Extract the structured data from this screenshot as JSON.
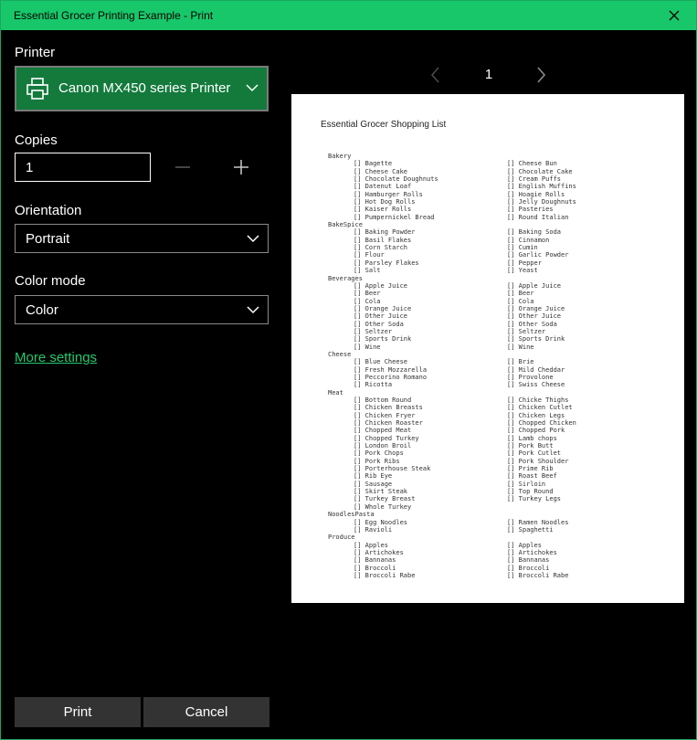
{
  "window": {
    "title": "Essential Grocer Printing Example - Print"
  },
  "printer": {
    "label": "Printer",
    "selected": "Canon MX450 series Printer"
  },
  "copies": {
    "label": "Copies",
    "value": "1"
  },
  "orientation": {
    "label": "Orientation",
    "selected": "Portrait"
  },
  "color_mode": {
    "label": "Color mode",
    "selected": "Color"
  },
  "more_settings": "More settings",
  "buttons": {
    "print": "Print",
    "cancel": "Cancel"
  },
  "pager": {
    "page": "1"
  },
  "preview": {
    "title": "Essential Grocer Shopping List",
    "categories": [
      {
        "name": "Bakery",
        "items": [
          [
            "[] Bagette",
            "[] Cheese Bun"
          ],
          [
            "[] Cheese Cake",
            "[] Chocolate Cake"
          ],
          [
            "[] Chocolate Doughnuts",
            "[] Cream Puffs"
          ],
          [
            "[] Datenut Loaf",
            "[] English Muffins"
          ],
          [
            "[] Hamburger Rolls",
            "[] Hoagie Rolls"
          ],
          [
            "[] Hot Dog Rolls",
            "[] Jelly Doughnuts"
          ],
          [
            "[] Kaiser Rolls",
            "[] Pasteries"
          ],
          [
            "[] Pumpernickel Bread",
            "[] Round Italian"
          ]
        ]
      },
      {
        "name": "BakeSpice",
        "items": [
          [
            "[] Baking Powder",
            "[] Baking Soda"
          ],
          [
            "[] Basil Flakes",
            "[] Cinnamon"
          ],
          [
            "[] Corn Starch",
            "[] Cumin"
          ],
          [
            "[] Flour",
            "[] Garlic Powder"
          ],
          [
            "[] Parsley Flakes",
            "[] Pepper"
          ],
          [
            "[] Salt",
            "[] Yeast"
          ]
        ]
      },
      {
        "name": "Beverages",
        "items": [
          [
            "[] Apple Juice",
            "[] Apple Juice"
          ],
          [
            "[] Beer",
            "[] Beer"
          ],
          [
            "[] Cola",
            "[] Cola"
          ],
          [
            "[] Orange Juice",
            "[] Orange Juice"
          ],
          [
            "[] Other Juice",
            "[] Other Juice"
          ],
          [
            "[] Other Soda",
            "[] Other Soda"
          ],
          [
            "[] Seltzer",
            "[] Seltzer"
          ],
          [
            "[] Sports Drink",
            "[] Sports Drink"
          ],
          [
            "[] Wine",
            "[] Wine"
          ]
        ]
      },
      {
        "name": "Cheese",
        "items": [
          [
            "[] Blue Cheese",
            "[] Brie"
          ],
          [
            "[] Fresh Mozzarella",
            "[] Mild Cheddar"
          ],
          [
            "[] Peccorino Romano",
            "[] Provolone"
          ],
          [
            "[] Ricotta",
            "[] Swiss Cheese"
          ]
        ]
      },
      {
        "name": "Meat",
        "items": [
          [
            "[] Bottom Round",
            "[] Chicke Thighs"
          ],
          [
            "[] Chicken Breasts",
            "[] Chicken Cutlet"
          ],
          [
            "[] Chicken Fryer",
            "[] Chicken Legs"
          ],
          [
            "[] Chicken Roaster",
            "[] Chopped Chicken"
          ],
          [
            "[] Chopped Meat",
            "[] Chopped Pork"
          ],
          [
            "[] Chopped Turkey",
            "[] Lamb chops"
          ],
          [
            "[] London Broil",
            "[] Pork Butt"
          ],
          [
            "[] Pork Chops",
            "[] Pork Cutlet"
          ],
          [
            "[] Pork Ribs",
            "[] Pork Shoulder"
          ],
          [
            "[] Porterhouse Steak",
            "[] Prime Rib"
          ],
          [
            "[] Rib Eye",
            "[] Roast Beef"
          ],
          [
            "[] Sausage",
            "[] Sirloin"
          ],
          [
            "[] Skirt Steak",
            "[] Top Round"
          ],
          [
            "[] Turkey Breast",
            "[] Turkey Legs"
          ],
          [
            "[] Whole Turkey",
            ""
          ]
        ]
      },
      {
        "name": "NoodlesPasta",
        "items": [
          [
            "[] Egg Noodles",
            "[] Ramen Noodles"
          ],
          [
            "[] Ravioli",
            "[] Spaghetti"
          ]
        ]
      },
      {
        "name": "Produce",
        "items": [
          [
            "[] Apples",
            "[] Apples"
          ],
          [
            "[] Artichokes",
            "[] Artichokes"
          ],
          [
            "[] Bannanas",
            "[] Bannanas"
          ],
          [
            "[] Broccoli",
            "[] Broccoli"
          ],
          [
            "[] Broccoli Rabe",
            "[] Broccoli Rabe"
          ]
        ]
      }
    ]
  },
  "icons": {
    "close": "close-icon",
    "printer": "printer-icon",
    "chevron": "chevron-down-icon",
    "minus": "minus-icon",
    "plus": "plus-icon",
    "prev": "chevron-left-icon",
    "next": "chevron-right-icon"
  },
  "colors": {
    "titlebar": "#18c76a",
    "accent": "#137a3c",
    "link": "#24c96e",
    "button": "#333333"
  }
}
